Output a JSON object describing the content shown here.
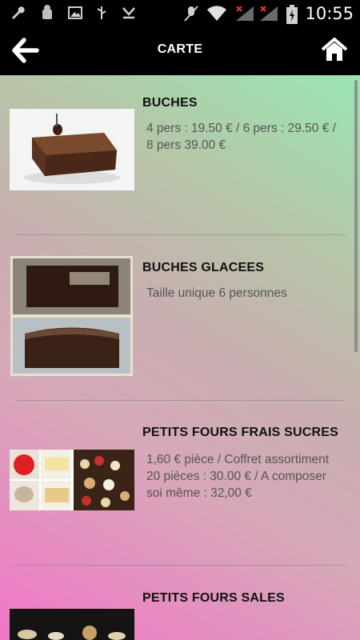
{
  "status_bar": {
    "time": "10:55",
    "icons": [
      "wrench-icon",
      "android-debug-icon",
      "image-icon",
      "usb-icon",
      "download-icon",
      "mute-icon",
      "wifi-icon",
      "signal-icon",
      "signal-icon",
      "battery-icon"
    ]
  },
  "app_bar": {
    "title": "CARTE",
    "back_icon": "back-arrow-icon",
    "home_icon": "home-icon"
  },
  "items": [
    {
      "name": "BUCHES",
      "description": "4 pers : 19.50 € / 6 pers : 29.50 € / 8 pers 39.00 €"
    },
    {
      "name": "BUCHES GLACEES",
      "description": "Taille unique 6 personnes"
    },
    {
      "name": "PETITS FOURS FRAIS SUCRES",
      "description": "1,60 € pièce / Coffret assortiment 20 pièces : 30.00 € / A composer soi même : 32,00 €"
    },
    {
      "name": "PETITS FOURS SALES",
      "description": ""
    }
  ],
  "colors": {
    "bar": "#000000",
    "gradient_start": "#f276c8",
    "gradient_end": "#99e6b3"
  }
}
